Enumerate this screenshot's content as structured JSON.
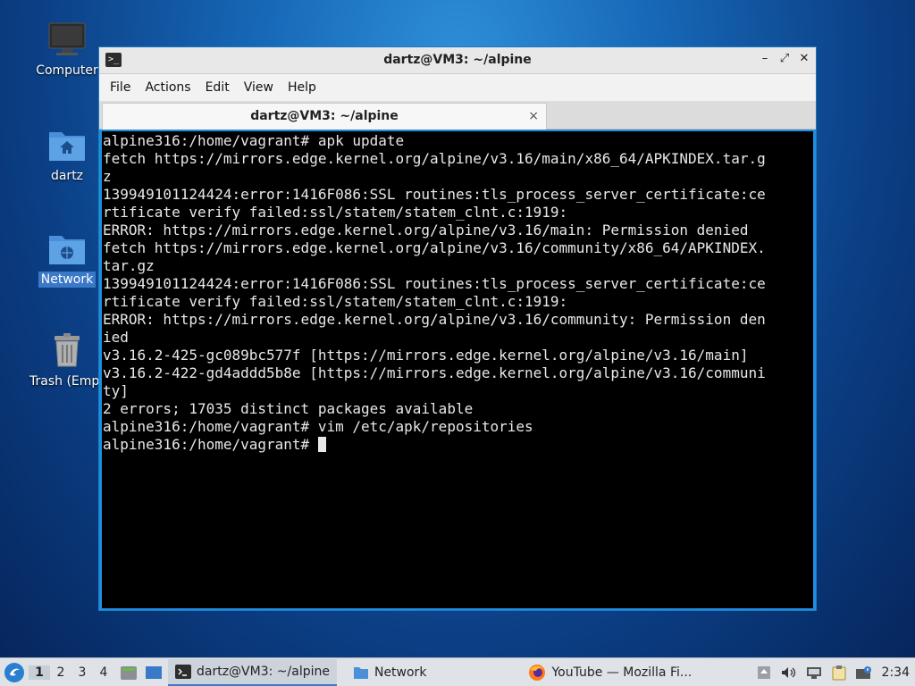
{
  "desktop": {
    "icons": [
      {
        "label": "Computer"
      },
      {
        "label": "dartz"
      },
      {
        "label": "Network"
      },
      {
        "label": "Trash (Empty)"
      }
    ]
  },
  "window": {
    "title": "dartz@VM3: ~/alpine",
    "menu": [
      "File",
      "Actions",
      "Edit",
      "View",
      "Help"
    ],
    "tab_title": "dartz@VM3: ~/alpine",
    "tab_close": "×",
    "controls": {
      "minimize": "–",
      "maximize": "⤢",
      "close": "✕"
    }
  },
  "terminal": {
    "lines": [
      "alpine316:/home/vagrant# apk update",
      "fetch https://mirrors.edge.kernel.org/alpine/v3.16/main/x86_64/APKINDEX.tar.g",
      "z",
      "139949101124424:error:1416F086:SSL routines:tls_process_server_certificate:ce",
      "rtificate verify failed:ssl/statem/statem_clnt.c:1919:",
      "ERROR: https://mirrors.edge.kernel.org/alpine/v3.16/main: Permission denied",
      "fetch https://mirrors.edge.kernel.org/alpine/v3.16/community/x86_64/APKINDEX.",
      "tar.gz",
      "139949101124424:error:1416F086:SSL routines:tls_process_server_certificate:ce",
      "rtificate verify failed:ssl/statem/statem_clnt.c:1919:",
      "ERROR: https://mirrors.edge.kernel.org/alpine/v3.16/community: Permission den",
      "ied",
      "v3.16.2-425-gc089bc577f [https://mirrors.edge.kernel.org/alpine/v3.16/main]",
      "v3.16.2-422-gd4addd5b8e [https://mirrors.edge.kernel.org/alpine/v3.16/communi",
      "ty]",
      "2 errors; 17035 distinct packages available",
      "alpine316:/home/vagrant# vim /etc/apk/repositories"
    ],
    "prompt": "alpine316:/home/vagrant# "
  },
  "taskbar": {
    "workspaces": [
      "1",
      "2",
      "3",
      "4"
    ],
    "tasks": [
      {
        "label": "dartz@VM3: ~/alpine"
      },
      {
        "label": "Network"
      },
      {
        "label": "YouTube — Mozilla Fi..."
      }
    ],
    "clock": "2:34"
  }
}
